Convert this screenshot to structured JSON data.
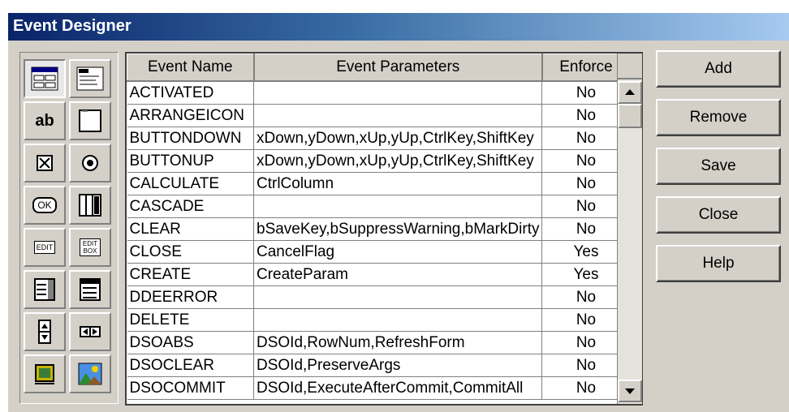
{
  "window": {
    "title": "Event Designer"
  },
  "toolbox": [
    {
      "icon": "form-designer-icon"
    },
    {
      "icon": "file-menu-icon"
    },
    {
      "icon": "label-text-icon",
      "text": "ab"
    },
    {
      "icon": "frame-icon"
    },
    {
      "icon": "checkbox-icon"
    },
    {
      "icon": "radio-button-icon"
    },
    {
      "icon": "ok-button-icon",
      "text": "OK"
    },
    {
      "icon": "column-grid-icon"
    },
    {
      "icon": "edit-field-icon",
      "text": "EDIT"
    },
    {
      "icon": "edit-box-icon",
      "text": "EDIT BOX"
    },
    {
      "icon": "listbox-icon"
    },
    {
      "icon": "combobox-icon"
    },
    {
      "icon": "spinner-icon"
    },
    {
      "icon": "horizontal-scroll-icon"
    },
    {
      "icon": "image-control-icon"
    },
    {
      "icon": "picture-icon"
    }
  ],
  "grid": {
    "columns": [
      "Event Name",
      "Event Parameters",
      "Enforce"
    ],
    "rows": [
      [
        "ACTIVATED",
        "",
        "No"
      ],
      [
        "ARRANGEICON",
        "",
        "No"
      ],
      [
        "BUTTONDOWN",
        "xDown,yDown,xUp,yUp,CtrlKey,ShiftKey",
        "No"
      ],
      [
        "BUTTONUP",
        "xDown,yDown,xUp,yUp,CtrlKey,ShiftKey",
        "No"
      ],
      [
        "CALCULATE",
        "CtrlColumn",
        "No"
      ],
      [
        "CASCADE",
        "",
        "No"
      ],
      [
        "CLEAR",
        "bSaveKey,bSuppressWarning,bMarkDirty",
        "No"
      ],
      [
        "CLOSE",
        "CancelFlag",
        "Yes"
      ],
      [
        "CREATE",
        "CreateParam",
        "Yes"
      ],
      [
        "DDEERROR",
        "",
        "No"
      ],
      [
        "DELETE",
        "",
        "No"
      ],
      [
        "DSOABS",
        "DSOId,RowNum,RefreshForm",
        "No"
      ],
      [
        "DSOCLEAR",
        "DSOId,PreserveArgs",
        "No"
      ],
      [
        "DSOCOMMIT",
        "DSOId,ExecuteAfterCommit,CommitAll",
        "No"
      ]
    ]
  },
  "buttons": {
    "add": "Add",
    "remove": "Remove",
    "save": "Save",
    "close": "Close",
    "help": "Help"
  },
  "colors": {
    "titlebar_start": "#0a246a",
    "titlebar_end": "#a6caf0",
    "face": "#d4d0c8"
  }
}
